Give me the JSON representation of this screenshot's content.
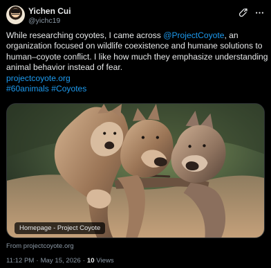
{
  "author": {
    "name": "Yichen Cui",
    "handle": "@yichc19",
    "avatar_icon": "user-avatar-icon"
  },
  "header_actions": [
    {
      "icon": "grok-icon"
    },
    {
      "icon": "more-options-icon"
    }
  ],
  "post": {
    "line1_prefix": "While researching coyotes, I came across ",
    "line1_mention": "@ProjectCoyote",
    "line1_suffix": ", an",
    "line2": "organization focused on wildlife coexistence and humane solutions to",
    "line3": "human–coyote conflict. I like how much they emphasize understanding",
    "line4": "animal behavior instead of fear.",
    "link": "projectcoyote.org",
    "hashtag1": "#60animals",
    "hashtag2": "#Coyotes"
  },
  "media": {
    "card_title": "Homepage - Project Coyote",
    "source": "From projectcoyote.org"
  },
  "meta": {
    "time": "11:12 PM",
    "separator": "·",
    "date": "May 15, 2026",
    "views_count": "10",
    "views_label": "Views"
  },
  "colors": {
    "background": "#000000",
    "text": "#e7e9ea",
    "muted": "#8b98a5",
    "accent": "#1d9bf0"
  }
}
